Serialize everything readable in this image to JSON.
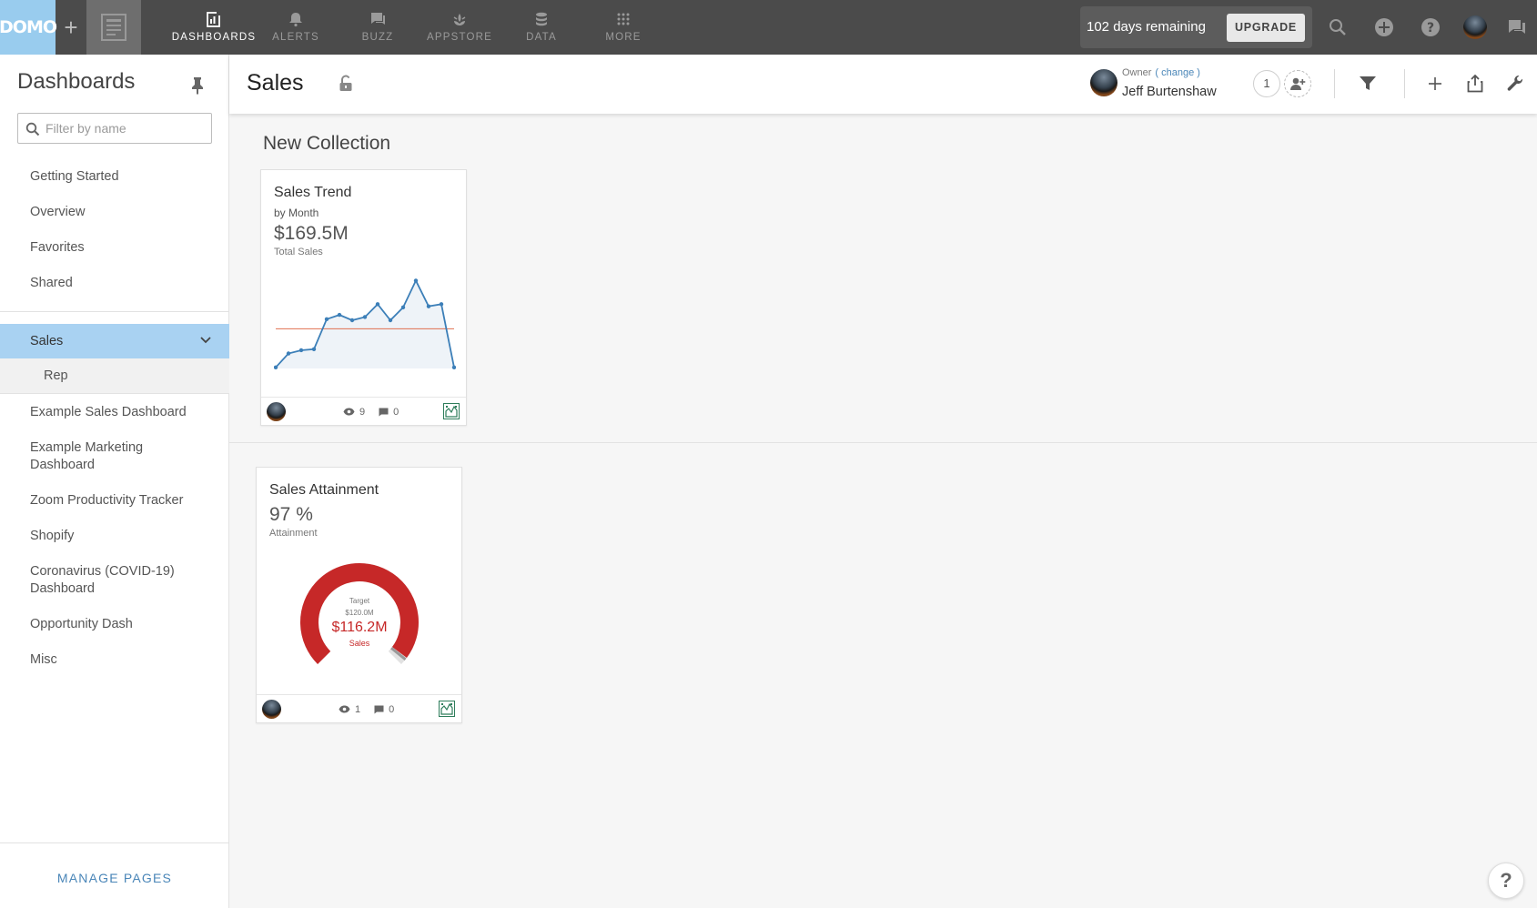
{
  "topbar": {
    "logo": "DOMO",
    "nav": [
      {
        "label": "DASHBOARDS",
        "icon": "dashboards-icon",
        "active": true
      },
      {
        "label": "ALERTS",
        "icon": "bell-icon",
        "active": false
      },
      {
        "label": "BUZZ",
        "icon": "chat-icon",
        "active": false
      },
      {
        "label": "APPSTORE",
        "icon": "appstore-icon",
        "active": false
      },
      {
        "label": "DATA",
        "icon": "database-icon",
        "active": false
      },
      {
        "label": "MORE",
        "icon": "grid-icon",
        "active": false
      }
    ],
    "trial_text": "102 days remaining",
    "upgrade_label": "UPGRADE"
  },
  "sidebar": {
    "title": "Dashboards",
    "filter_placeholder": "Filter by name",
    "items_top": [
      "Getting Started",
      "Overview",
      "Favorites",
      "Shared"
    ],
    "selected": "Sales",
    "sub_item": "Rep",
    "items_bottom": [
      "Example Sales Dashboard",
      "Example Marketing Dashboard",
      "Zoom Productivity Tracker",
      "Shopify",
      "Coronavirus (COVID-19) Dashboard",
      "Opportunity Dash",
      "Misc"
    ],
    "manage_label": "MANAGE PAGES"
  },
  "page": {
    "title": "Sales",
    "owner_label": "Owner",
    "owner_change": "( change )",
    "owner_name": "Jeff Burtenshaw",
    "share_count": "1"
  },
  "collection": {
    "title": "New Collection"
  },
  "cards": [
    {
      "title": "Sales Trend",
      "subtitle": "by Month",
      "value": "$169.5M",
      "summary": "Total Sales",
      "views": "9",
      "comments": "0"
    },
    {
      "title": "Sales Attainment",
      "value": "97 %",
      "summary": "Attainment",
      "gauge_target_label": "Target",
      "gauge_target_value": "$120.0M",
      "gauge_value": "$116.2M",
      "gauge_value_label": "Sales",
      "views": "1",
      "comments": "0"
    }
  ],
  "chart_data": [
    {
      "type": "area",
      "values": [
        1,
        14,
        17,
        18,
        46,
        50,
        45,
        48,
        60,
        45,
        57,
        82,
        58,
        60,
        1
      ],
      "reference_line": 37,
      "ylim": [
        0,
        90
      ],
      "line_color": "#3c7fb8",
      "reference_color": "#e07050"
    },
    {
      "type": "gauge",
      "value": 0.97,
      "fill_color": "#c62828",
      "track_color": "#e2e2e2"
    }
  ],
  "colors": {
    "topbar": "#4b4b4b",
    "brand": "#99ccee",
    "selected_item": "#a9d2f2",
    "link": "#4a86b8"
  },
  "help_label": "?"
}
